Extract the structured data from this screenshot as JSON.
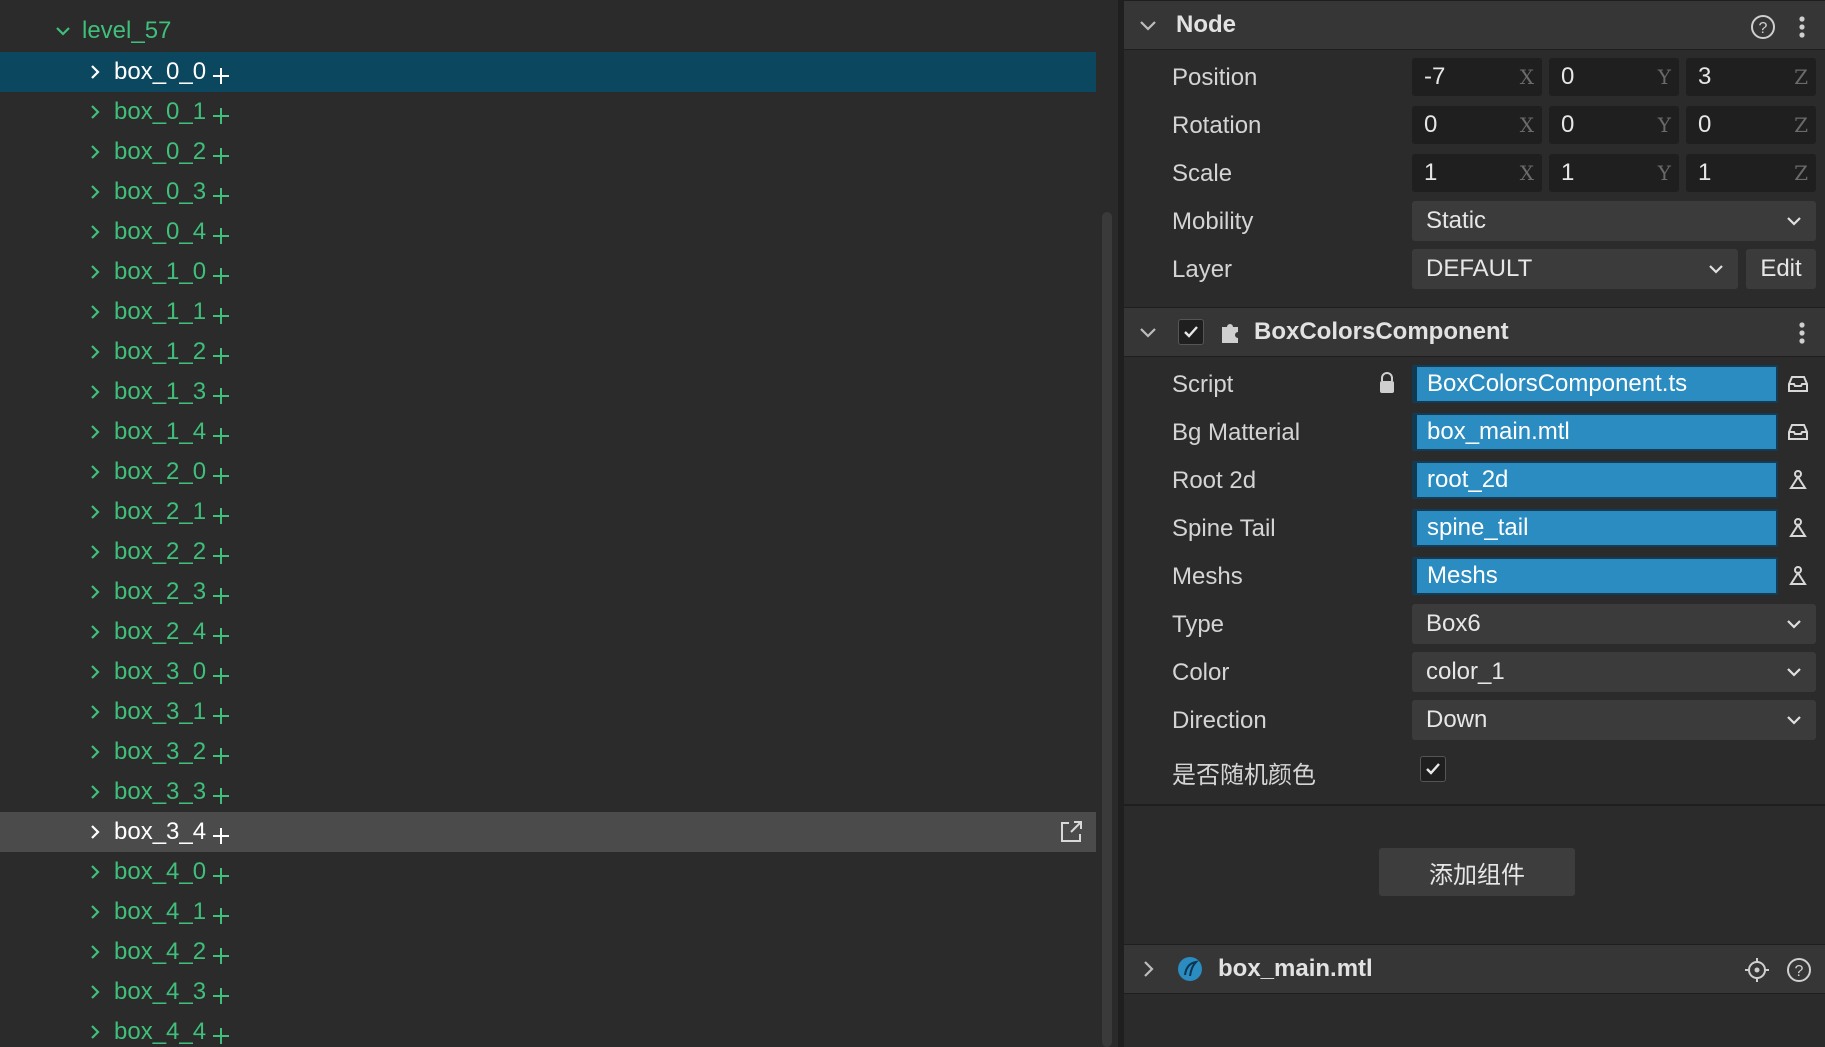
{
  "hierarchy": {
    "root": "level_57",
    "items": [
      "box_0_0",
      "box_0_1",
      "box_0_2",
      "box_0_3",
      "box_0_4",
      "box_1_0",
      "box_1_1",
      "box_1_2",
      "box_1_3",
      "box_1_4",
      "box_2_0",
      "box_2_1",
      "box_2_2",
      "box_2_3",
      "box_2_4",
      "box_3_0",
      "box_3_1",
      "box_3_2",
      "box_3_3",
      "box_3_4",
      "box_4_0",
      "box_4_1",
      "box_4_2",
      "box_4_3",
      "box_4_4"
    ],
    "selected": "box_0_0",
    "hovered": "box_3_4"
  },
  "node": {
    "title": "Node",
    "position": {
      "label": "Position",
      "x": "-7",
      "y": "0",
      "z": "3"
    },
    "rotation": {
      "label": "Rotation",
      "x": "0",
      "y": "0",
      "z": "0"
    },
    "scale": {
      "label": "Scale",
      "x": "1",
      "y": "1",
      "z": "1"
    },
    "axis": {
      "x": "X",
      "y": "Y",
      "z": "Z"
    },
    "mobility": {
      "label": "Mobility",
      "value": "Static"
    },
    "layer": {
      "label": "Layer",
      "value": "DEFAULT",
      "edit": "Edit"
    }
  },
  "component": {
    "title": "BoxColorsComponent",
    "script": {
      "label": "Script",
      "value": "BoxColorsComponent.ts"
    },
    "bg_material": {
      "label": "Bg Matterial",
      "value": "box_main.mtl"
    },
    "root_2d": {
      "label": "Root 2d",
      "value": "root_2d"
    },
    "spine_tail": {
      "label": "Spine Tail",
      "value": "spine_tail"
    },
    "meshs": {
      "label": "Meshs",
      "value": "Meshs"
    },
    "type": {
      "label": "Type",
      "value": "Box6"
    },
    "color": {
      "label": "Color",
      "value": "color_1"
    },
    "direction": {
      "label": "Direction",
      "value": "Down"
    },
    "random_color": {
      "label": "是否随机颜色",
      "checked": true
    }
  },
  "add_component": "添加组件",
  "material": {
    "title": "box_main.mtl"
  },
  "colors": {
    "accent": "#2a8cc0",
    "tree_text": "#3fbf7a",
    "selected_row": "#0b4860"
  }
}
